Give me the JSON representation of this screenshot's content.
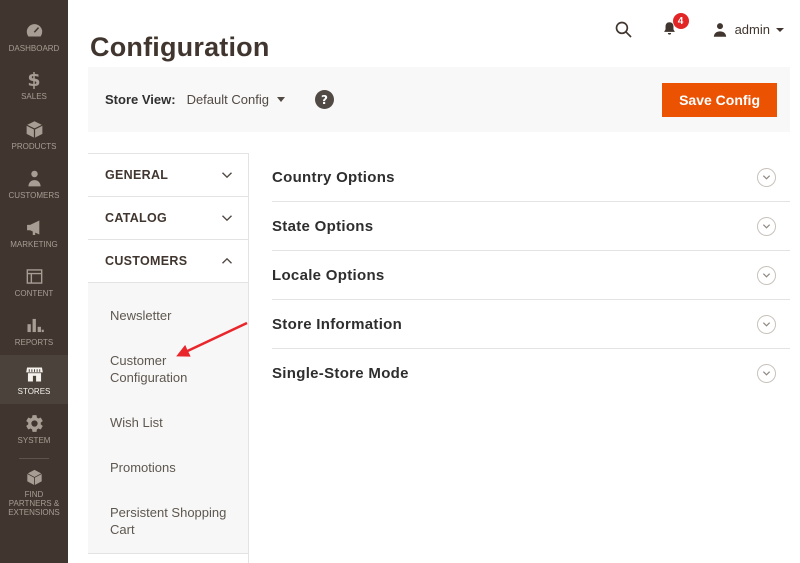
{
  "header": {
    "title": "Configuration",
    "notifications_count": "4",
    "user_name": "admin"
  },
  "toolbar": {
    "store_view_label": "Store View:",
    "store_view_value": "Default Config",
    "help_icon": "?",
    "save_button_label": "Save Config"
  },
  "sidebar": {
    "items": [
      {
        "label": "DASHBOARD",
        "icon": "dashboard-gauge",
        "active": false
      },
      {
        "label": "SALES",
        "icon": "dollar-sign",
        "active": false
      },
      {
        "label": "PRODUCTS",
        "icon": "cube",
        "active": false
      },
      {
        "label": "CUSTOMERS",
        "icon": "person",
        "active": false
      },
      {
        "label": "MARKETING",
        "icon": "megaphone",
        "active": false
      },
      {
        "label": "CONTENT",
        "icon": "window-layout",
        "active": false
      },
      {
        "label": "REPORTS",
        "icon": "bar-chart",
        "active": false
      },
      {
        "label": "STORES",
        "icon": "storefront",
        "active": true
      },
      {
        "label": "SYSTEM",
        "icon": "gear",
        "active": false
      },
      {
        "label": "FIND PARTNERS & EXTENSIONS",
        "icon": "package",
        "active": false
      }
    ]
  },
  "config_nav": {
    "sections": [
      {
        "label": "GENERAL",
        "expanded": false
      },
      {
        "label": "CATALOG",
        "expanded": false
      },
      {
        "label": "CUSTOMERS",
        "expanded": true
      }
    ],
    "customers_subitems": [
      {
        "label": "Newsletter"
      },
      {
        "label": "Customer Configuration"
      },
      {
        "label": "Wish List"
      },
      {
        "label": "Promotions"
      },
      {
        "label": "Persistent Shopping Cart"
      }
    ]
  },
  "content": {
    "sections": [
      {
        "title": "Country Options"
      },
      {
        "title": "State Options"
      },
      {
        "title": "Locale Options"
      },
      {
        "title": "Store Information"
      },
      {
        "title": "Single-Store Mode"
      }
    ]
  },
  "annotation": {
    "type": "red-arrow",
    "points_to": "Customer Configuration",
    "color": "#e8262c"
  },
  "colors": {
    "accent_orange": "#eb5202",
    "badge_red": "#e22626",
    "sidebar_bg": "#41362f",
    "sidebar_active_bg": "#4a423b",
    "band_gray": "#f8f8f8",
    "border_gray": "#e3e3e3"
  }
}
